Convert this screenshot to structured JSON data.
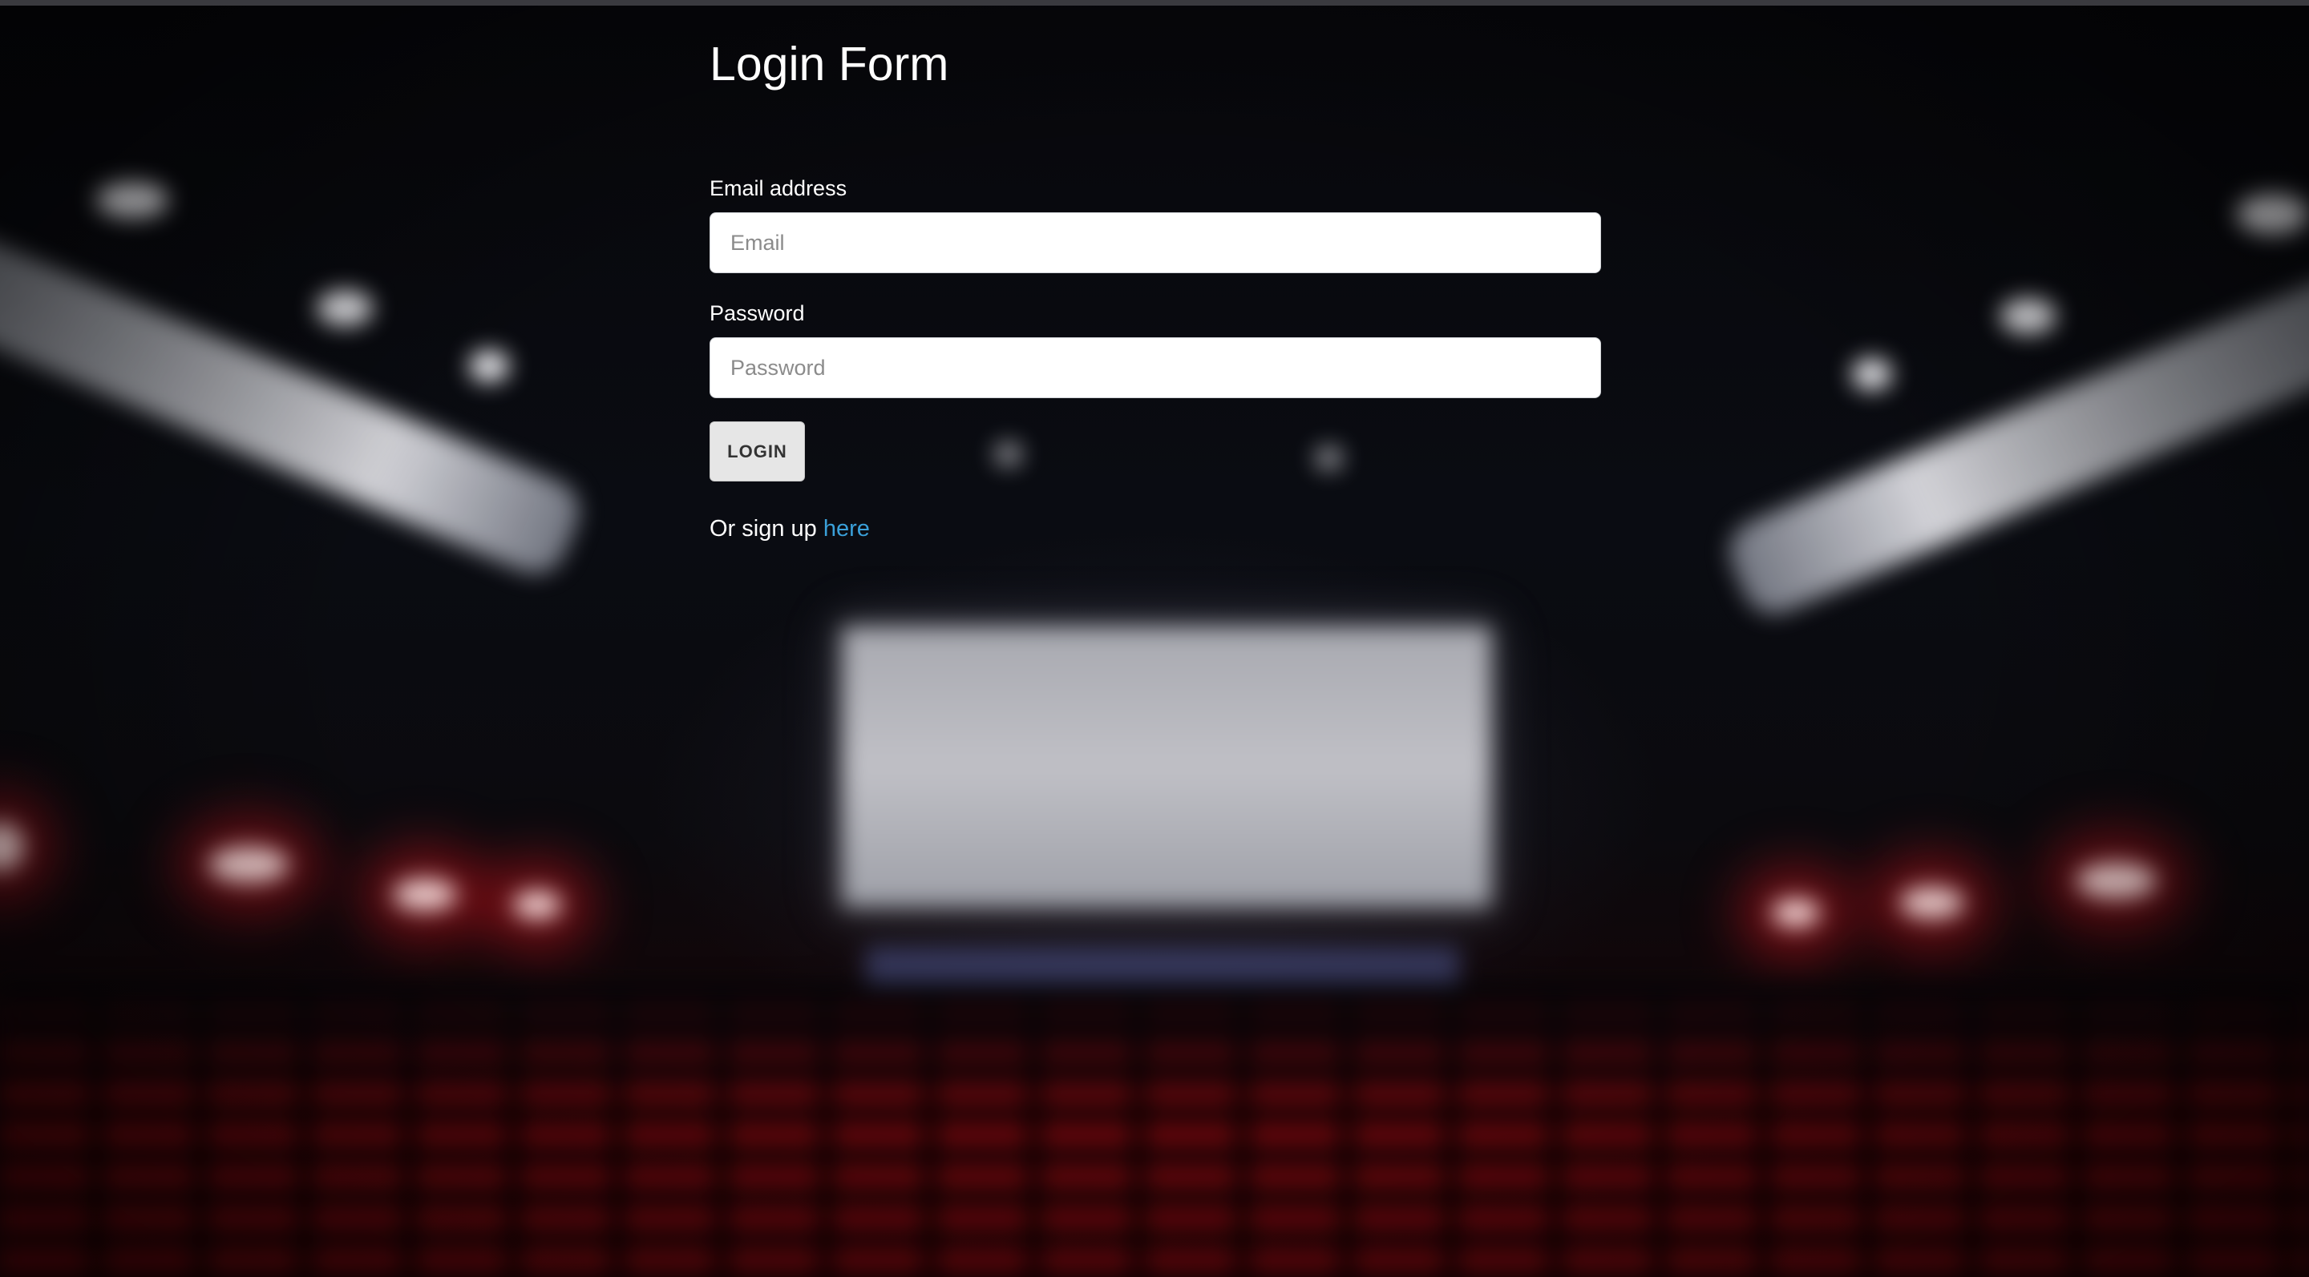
{
  "form": {
    "title": "Login Form",
    "email_label": "Email address",
    "email_placeholder": "Email",
    "email_value": "",
    "password_label": "Password",
    "password_placeholder": "Password",
    "password_value": "",
    "login_button": "LOGIN",
    "signup_prefix": "Or sign up ",
    "signup_link": "here"
  },
  "colors": {
    "link": "#3aa0d9",
    "button_bg": "#e6e6e6",
    "text": "#ffffff"
  }
}
